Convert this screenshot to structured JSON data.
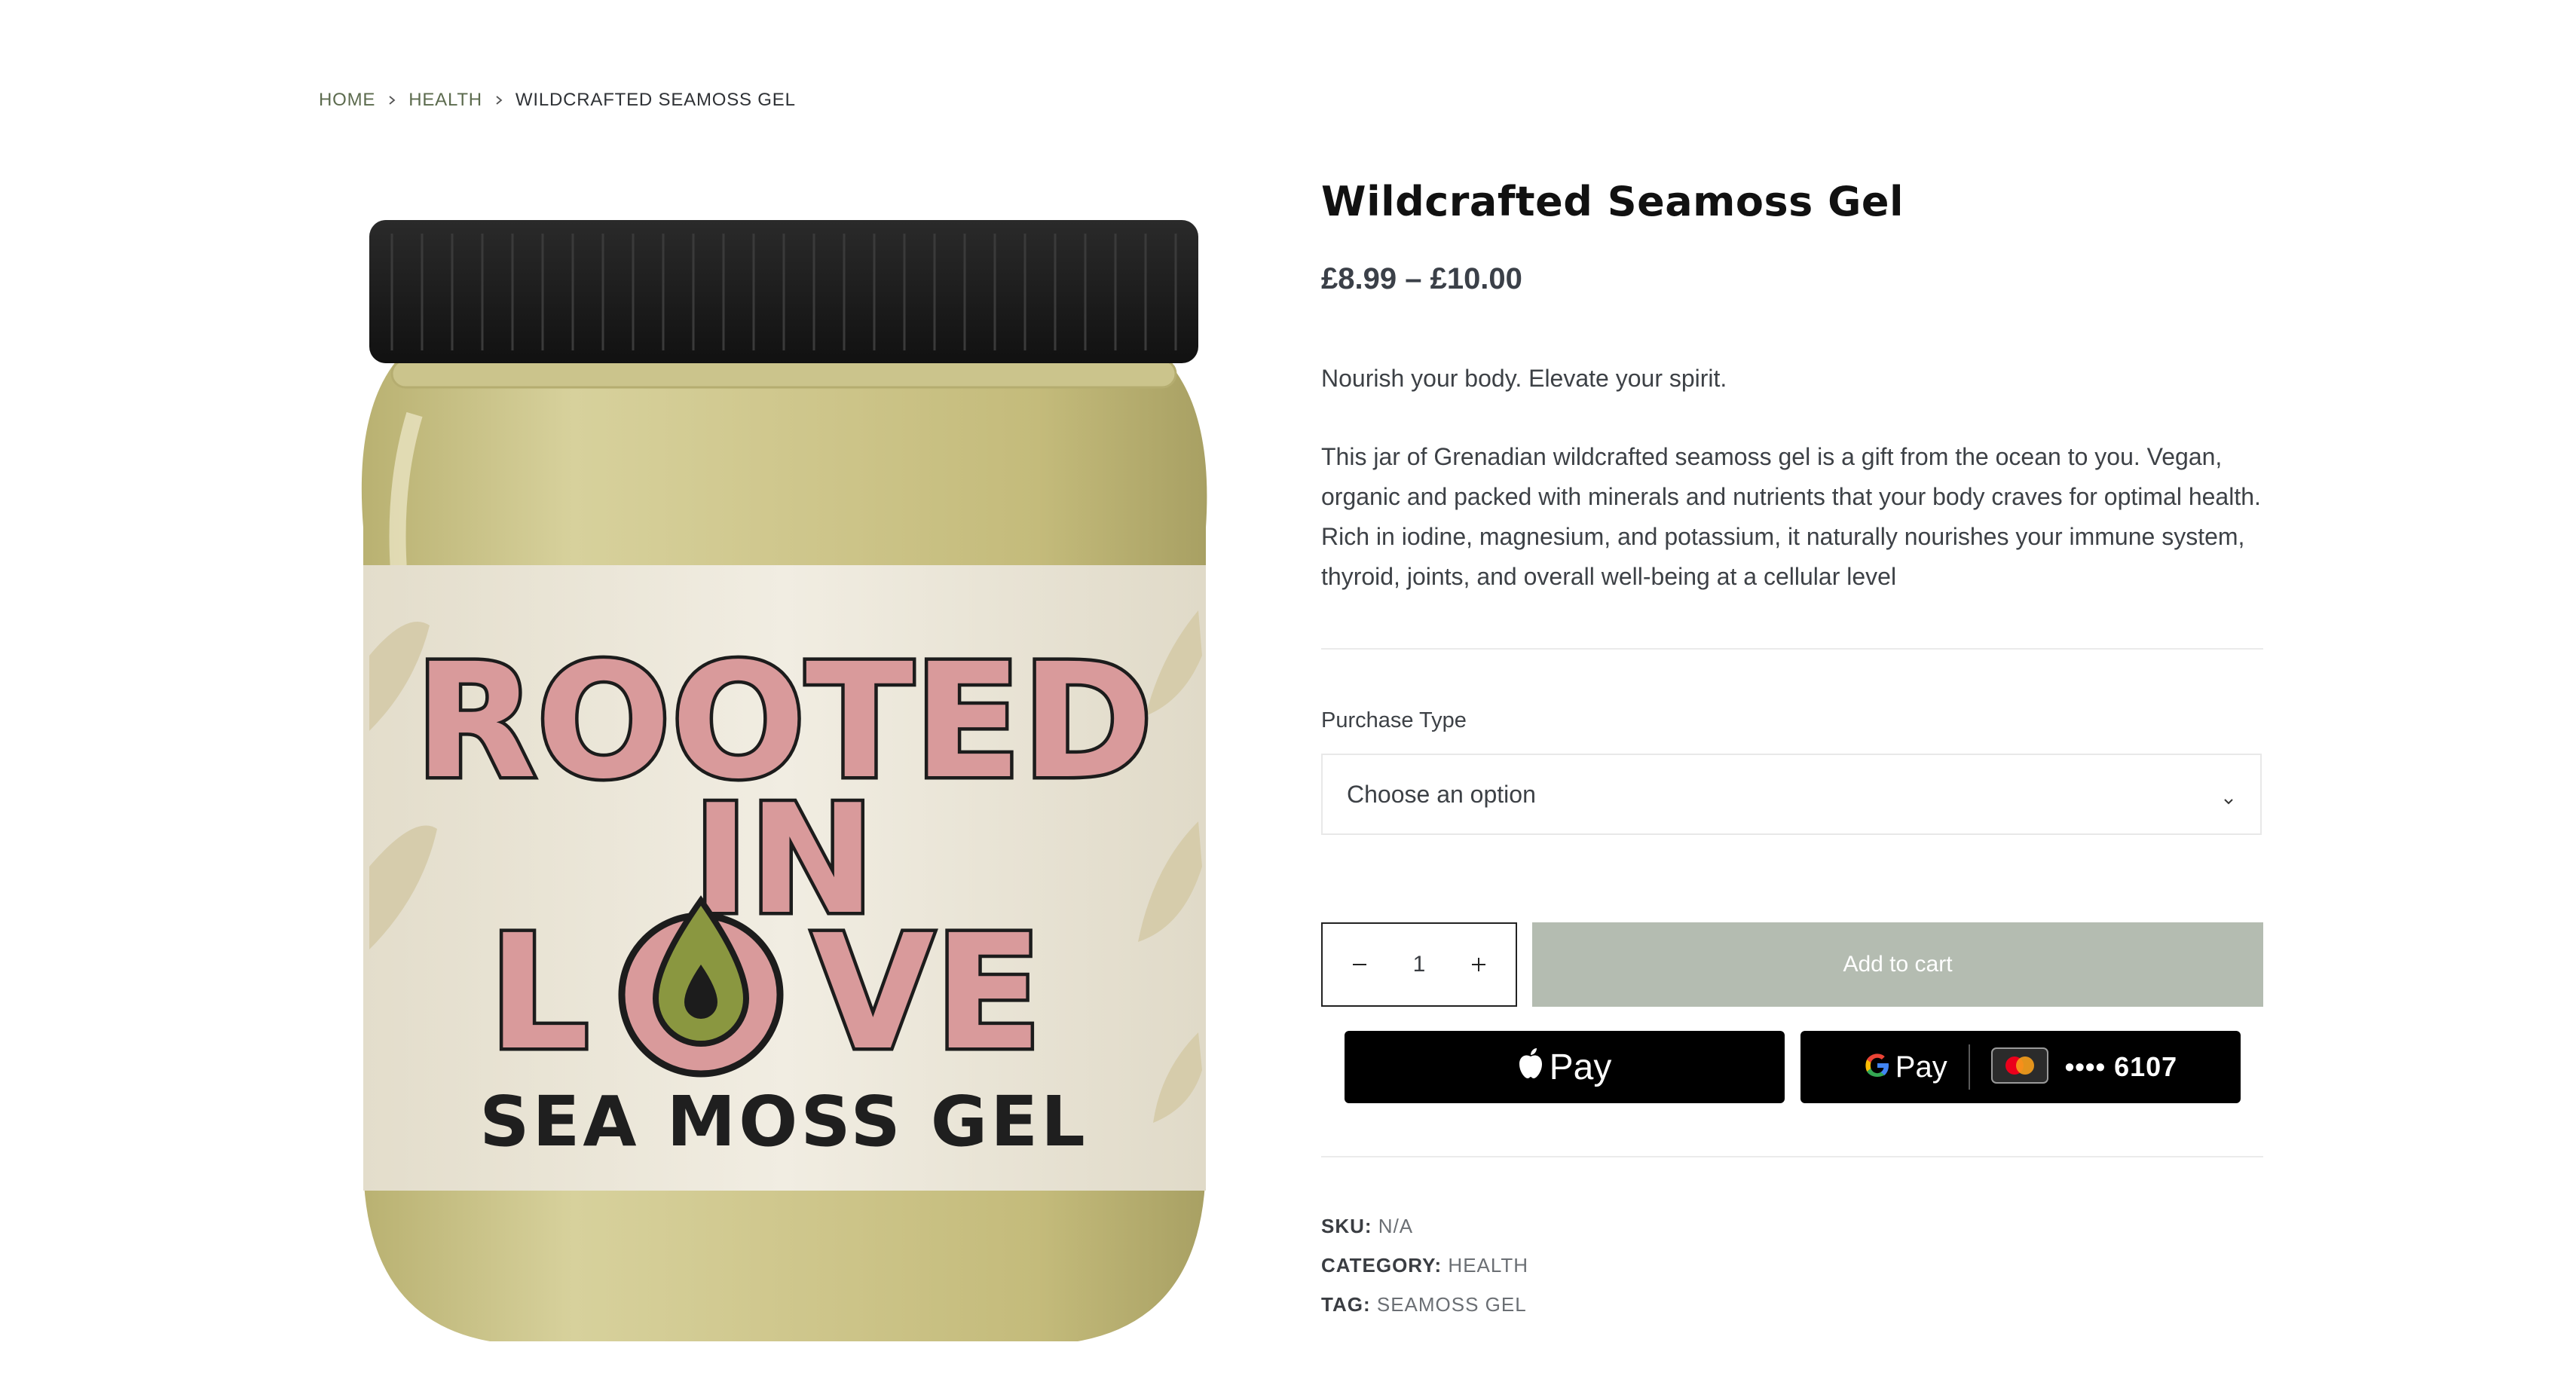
{
  "breadcrumb": {
    "home": "HOME",
    "category": "HEALTH",
    "current": "WILDCRAFTED SEAMOSS GEL"
  },
  "product": {
    "title": "Wildcrafted Seamoss Gel",
    "price": "£8.99 – £10.00",
    "tagline": "Nourish your body. Elevate your spirit.",
    "description": "This jar of Grenadian wildcrafted seamoss gel is a gift from the ocean to you. Vegan, organic and packed with minerals and nutrients that your body craves for optimal health. Rich in iodine, magnesium, and potassium, it naturally nourishes your immune system, thyroid, joints, and overall well-being at a cellular level",
    "image": {
      "label_line1": "ROOTED",
      "label_line2": "IN",
      "label_line3_a": "L",
      "label_line3_b": "VE",
      "label_bottom": "SEA MOSS GEL"
    }
  },
  "purchase": {
    "label": "Purchase Type",
    "selected": "Choose an option"
  },
  "cart": {
    "quantity": "1",
    "add_label": "Add to cart"
  },
  "payments": {
    "apple_pay_label": "Pay",
    "google_pay_label": "Pay",
    "card_digits": "•••• 6107"
  },
  "meta": {
    "sku_key": "SKU:",
    "sku_value": "N/A",
    "category_key": "CATEGORY:",
    "category_value": "HEALTH",
    "tag_key": "TAG:",
    "tag_value": "SEAMOSS GEL"
  },
  "colors": {
    "accent_green": "#5c6b4e",
    "cart_button": "#b4bcb1",
    "jar_gel": "#c9c28a",
    "label_pink": "#d99a9b"
  }
}
